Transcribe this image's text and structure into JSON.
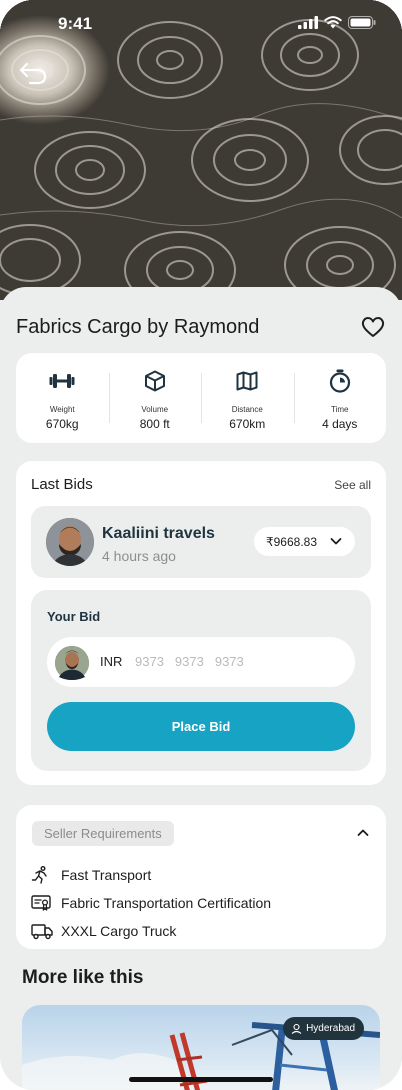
{
  "status_bar": {
    "time": "9:41"
  },
  "header": {
    "back_icon": "back-arrow-icon"
  },
  "product": {
    "title": "Fabrics Cargo by Raymond"
  },
  "specs": [
    {
      "icon": "dumbbell-icon",
      "label": "Weight",
      "value": "670kg"
    },
    {
      "icon": "cube-icon",
      "label": "Volume",
      "value": "800 ft"
    },
    {
      "icon": "map-icon",
      "label": "Distance",
      "value": "670km"
    },
    {
      "icon": "stopwatch-icon",
      "label": "Time",
      "value": "4 days"
    }
  ],
  "last_bids": {
    "title": "Last Bids",
    "see_all": "See all",
    "top_bid": {
      "name": "Kaaliini travels",
      "time": "4 hours ago",
      "amount": "₹9668.83"
    }
  },
  "your_bid": {
    "title": "Your Bid",
    "currency": "INR",
    "placeholders": [
      "9373",
      "9373",
      "9373"
    ],
    "button": "Place Bid"
  },
  "seller_requirements": {
    "title": "Seller Requirements",
    "items": [
      {
        "icon": "running-person-icon",
        "label": "Fast Transport"
      },
      {
        "icon": "certificate-icon",
        "label": "Fabric Transportation Certification"
      },
      {
        "icon": "truck-icon",
        "label": "XXXL Cargo Truck"
      }
    ]
  },
  "more_like_this": {
    "title": "More like this",
    "card": {
      "location": "Hyderabad"
    }
  },
  "colors": {
    "accent": "#17a3c4",
    "background": "#eceeed",
    "dark_text": "#1f3440"
  }
}
